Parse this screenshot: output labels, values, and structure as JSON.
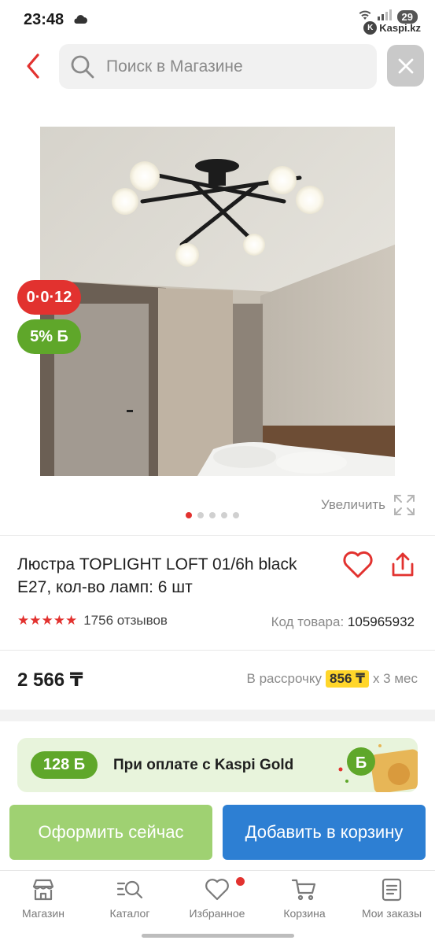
{
  "status_bar": {
    "time": "23:48",
    "battery": "29",
    "app_badge": "Kaspi.kz"
  },
  "search": {
    "placeholder": "Поиск в Магазине"
  },
  "product": {
    "badges": {
      "installment": "0·0·12",
      "bonus": "5% Б"
    },
    "zoom_label": "Увеличить",
    "image_count": 5,
    "active_image": 1,
    "title": "Люстра TOPLIGHT LOFT 01/6h black E27, кол-во ламп: 6 шт",
    "rating_stars": 5,
    "reviews": "1756 отзывов",
    "sku_label": "Код товара:",
    "sku_value": "105965932",
    "price": "2 566 ₸",
    "installment_prefix": "В рассрочку",
    "installment_amount": "856 ₸",
    "installment_suffix": "х 3 мес"
  },
  "kaspi_gold": {
    "bonus": "128 Б",
    "text": "При оплате с Kaspi Gold"
  },
  "actions": {
    "buy_now": "Оформить сейчас",
    "add_to_cart": "Добавить в корзину"
  },
  "bottom_nav": [
    {
      "label": "Магазин",
      "icon": "store-icon"
    },
    {
      "label": "Каталог",
      "icon": "catalog-search-icon"
    },
    {
      "label": "Избранное",
      "icon": "heart-icon",
      "has_badge": true
    },
    {
      "label": "Корзина",
      "icon": "cart-icon"
    },
    {
      "label": "Мои заказы",
      "icon": "orders-icon"
    }
  ],
  "colors": {
    "accent_red": "#e2322f",
    "bonus_green": "#5fa72a",
    "buy_green": "#9fd172",
    "cart_blue": "#2d7fd3",
    "installment_yellow": "#ffd62a"
  }
}
